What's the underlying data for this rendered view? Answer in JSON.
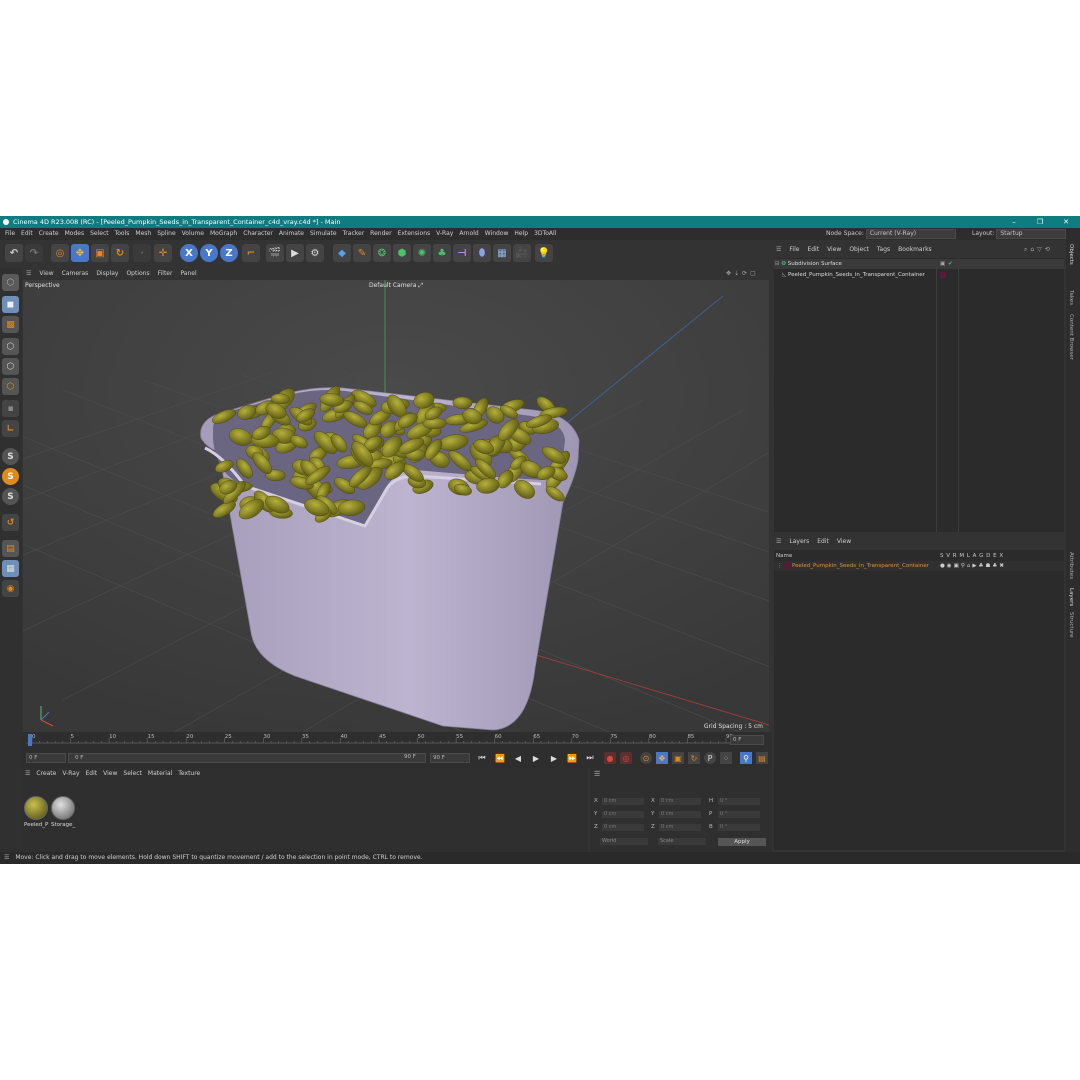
{
  "window": {
    "title": "Cinema 4D R23.008 (RC) - [Peeled_Pumpkin_Seeds_in_Transparent_Container_c4d_vray.c4d *] - Main",
    "minimize": "–",
    "maximize": "❐",
    "close": "✕"
  },
  "menubar": {
    "items": [
      "File",
      "Edit",
      "Create",
      "Modes",
      "Select",
      "Tools",
      "Mesh",
      "Spline",
      "Volume",
      "MoGraph",
      "Character",
      "Animate",
      "Simulate",
      "Tracker",
      "Render",
      "Extensions",
      "V-Ray",
      "Arnold",
      "Window",
      "Help",
      "3DToAll"
    ],
    "node_space_label": "Node Space:",
    "node_space_value": "Current (V-Ray)",
    "layout_label": "Layout:",
    "layout_value": "Startup"
  },
  "toolbar": {
    "axis_x": "X",
    "axis_y": "Y",
    "axis_z": "Z"
  },
  "viewport": {
    "menu": [
      "View",
      "Cameras",
      "Display",
      "Options",
      "Filter",
      "Panel"
    ],
    "projection": "Perspective",
    "camera": "Default Camera",
    "grid_spacing": "Grid Spacing : 5 cm"
  },
  "timeline": {
    "ticks": [
      "0",
      "5",
      "10",
      "15",
      "20",
      "25",
      "30",
      "35",
      "40",
      "45",
      "50",
      "55",
      "60",
      "65",
      "70",
      "75",
      "80",
      "85",
      "90"
    ],
    "current_frame": "0 F",
    "start_frame": "0 F",
    "range_start": "0 F",
    "range_end": "90 F",
    "end_frame": "90 F"
  },
  "material_manager": {
    "menu": [
      "Create",
      "V-Ray",
      "Edit",
      "View",
      "Select",
      "Material",
      "Texture"
    ],
    "materials": [
      {
        "name": "Peeled_P"
      },
      {
        "name": "Storage_"
      }
    ]
  },
  "coordinates": {
    "row1": {
      "a": "X",
      "av": "0 cm",
      "b": "X",
      "bv": "0 cm",
      "c": "H",
      "cv": "0 °"
    },
    "row2": {
      "a": "Y",
      "av": "0 cm",
      "b": "Y",
      "bv": "0 cm",
      "c": "P",
      "cv": "0 °"
    },
    "row3": {
      "a": "Z",
      "av": "0 cm",
      "b": "Z",
      "bv": "0 cm",
      "c": "B",
      "cv": "0 °"
    },
    "world": "World",
    "scale": "Scale",
    "apply": "Apply"
  },
  "object_manager": {
    "menu": [
      "File",
      "Edit",
      "View",
      "Object",
      "Tags",
      "Bookmarks"
    ],
    "objects": [
      {
        "name": "Subdivision Surface"
      },
      {
        "name": "Peeled_Pumpkin_Seeds_in_Transparent_Container"
      }
    ]
  },
  "layer_manager": {
    "menu": [
      "Layers",
      "Edit",
      "View"
    ],
    "name_header": "Name",
    "columns": "S V R M L A G D E X",
    "layers": [
      {
        "name": "Peeled_Pumpkin_Seeds_in_Transparent_Container"
      }
    ]
  },
  "side_tabs": [
    "Objects",
    "Takes",
    "Content Browser",
    "Attributes",
    "Layers",
    "Structure"
  ],
  "status": "Move: Click and drag to move elements. Hold down SHIFT to quantize movement / add to the selection in point mode, CTRL to remove.",
  "colors": {
    "titlebar": "#0f7c80",
    "accent_orange": "#e08a1e",
    "axis_blue": "#4a78c8",
    "container": "#b9b0cc",
    "seed": "#7a7a1e"
  }
}
